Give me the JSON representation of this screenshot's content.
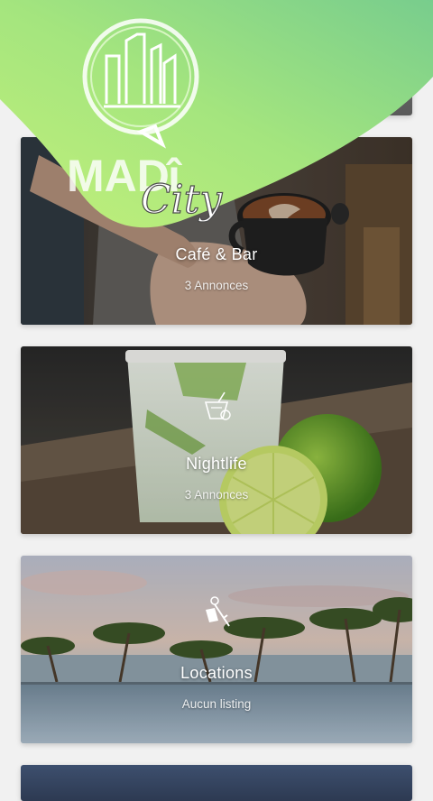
{
  "app": {
    "logo_text": "MADî City",
    "brand_colors": {
      "green_light": "#b9ee7a",
      "green_dark": "#7fd08c"
    }
  },
  "categories": [
    {
      "title": "Café & Bar",
      "count": "3 Annonces",
      "icon": "coffee-cup-icon"
    },
    {
      "title": "Nightlife",
      "count": "3 Annonces",
      "icon": "cocktail-icon"
    },
    {
      "title": "Locations",
      "count": "Aucun listing",
      "icon": "key-tag-icon"
    }
  ]
}
